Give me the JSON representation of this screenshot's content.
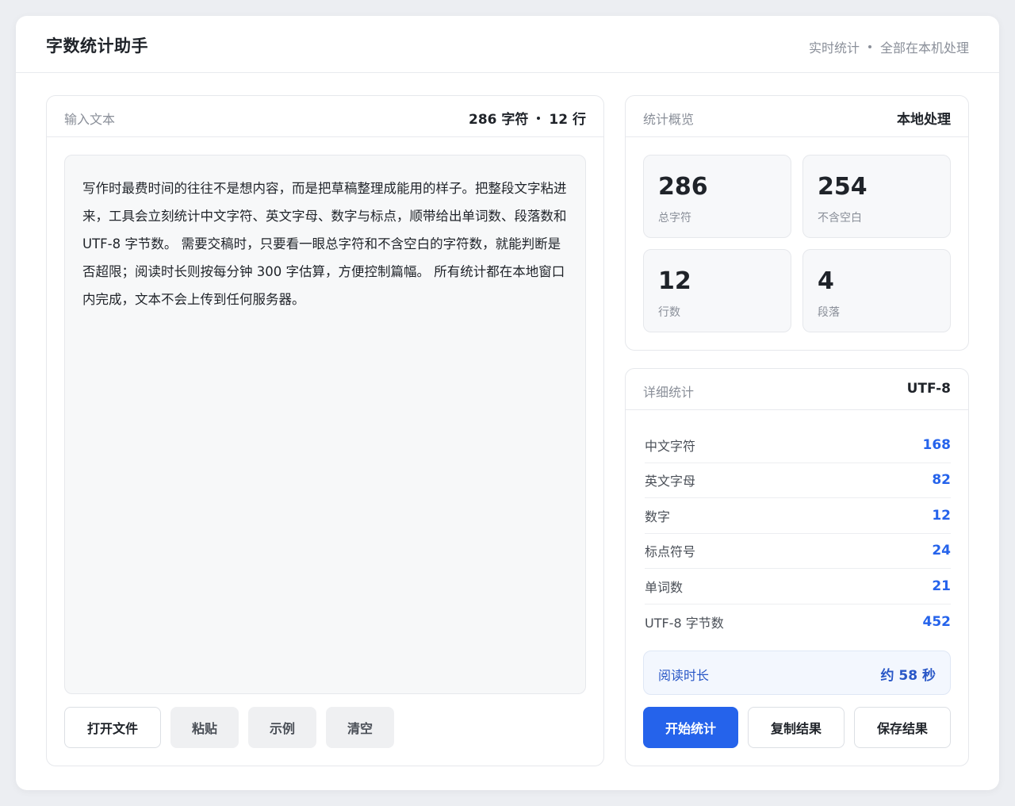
{
  "header": {
    "title": "字数统计助手",
    "subtitle_part1": "实时统计",
    "subtitle_part2": "全部在本机处理"
  },
  "input": {
    "label": "输入文本",
    "char_count": "286 字符",
    "line_count": "12 行",
    "text": "写作时最费时间的往往不是想内容，而是把草稿整理成能用的样子。把整段文字粘进来，工具会立刻统计中文字符、英文字母、数字与标点，顺带给出单词数、段落数和 UTF-8 字节数。 需要交稿时，只要看一眼总字符和不含空白的字符数，就能判断是否超限；阅读时长则按每分钟 300 字估算，方便控制篇幅。 所有统计都在本地窗口内完成，文本不会上传到任何服务器。",
    "buttons": {
      "open": "打开文件",
      "paste": "粘贴",
      "example": "示例",
      "clear": "清空"
    }
  },
  "overview": {
    "label": "统计概览",
    "meta": "本地处理",
    "stats": [
      {
        "value": "286",
        "label": "总字符"
      },
      {
        "value": "254",
        "label": "不含空白"
      },
      {
        "value": "12",
        "label": "行数"
      },
      {
        "value": "4",
        "label": "段落"
      }
    ]
  },
  "detail": {
    "label": "详细统计",
    "meta": "UTF-8",
    "rows": [
      {
        "key": "中文字符",
        "value": "168"
      },
      {
        "key": "英文字母",
        "value": "82"
      },
      {
        "key": "数字",
        "value": "12"
      },
      {
        "key": "标点符号",
        "value": "24"
      },
      {
        "key": "单词数",
        "value": "21"
      },
      {
        "key": "UTF-8 字节数",
        "value": "452"
      }
    ],
    "reading_label": "阅读时长",
    "reading_value": "约 58 秒",
    "buttons": {
      "start": "开始统计",
      "copy": "复制结果",
      "save": "保存结果"
    }
  },
  "colors": {
    "accent": "#2563eb",
    "background": "#eceef2",
    "card": "#ffffff"
  }
}
